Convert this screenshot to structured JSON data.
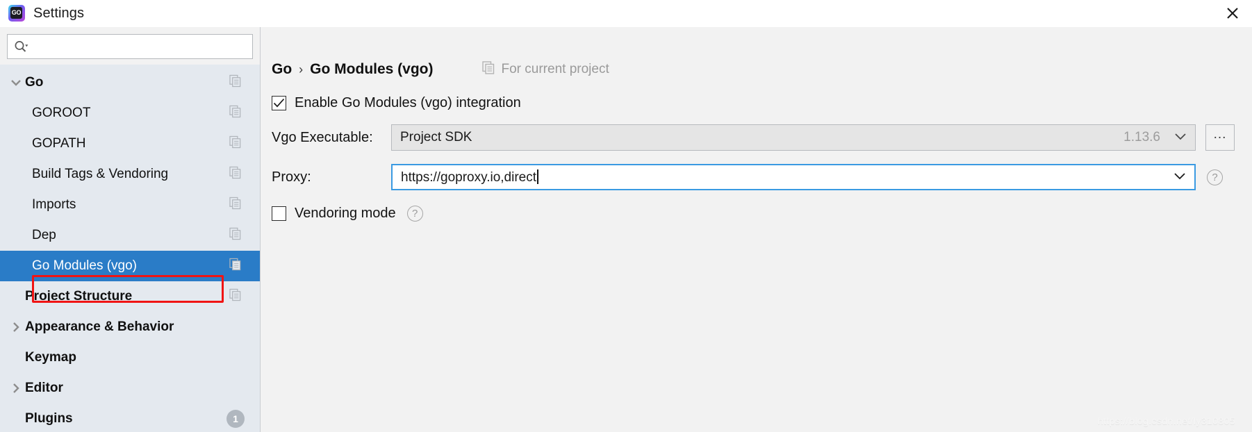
{
  "window": {
    "title": "Settings",
    "app_icon": "goland-icon",
    "app_icon_text": "GO",
    "close_label": "×"
  },
  "sidebar": {
    "search": {
      "placeholder": "",
      "value": "",
      "icon": "search-icon"
    },
    "items": [
      {
        "label": "Go",
        "level": 0,
        "bold": true,
        "twisty": "down",
        "copy": true,
        "selected": false
      },
      {
        "label": "GOROOT",
        "level": 1,
        "bold": false,
        "twisty": "none",
        "copy": true,
        "selected": false
      },
      {
        "label": "GOPATH",
        "level": 1,
        "bold": false,
        "twisty": "none",
        "copy": true,
        "selected": false
      },
      {
        "label": "Build Tags & Vendoring",
        "level": 1,
        "bold": false,
        "twisty": "none",
        "copy": true,
        "selected": false
      },
      {
        "label": "Imports",
        "level": 1,
        "bold": false,
        "twisty": "none",
        "copy": true,
        "selected": false
      },
      {
        "label": "Dep",
        "level": 1,
        "bold": false,
        "twisty": "none",
        "copy": true,
        "selected": false
      },
      {
        "label": "Go Modules (vgo)",
        "level": 1,
        "bold": false,
        "twisty": "none",
        "copy": true,
        "selected": true
      },
      {
        "label": "Project Structure",
        "level": 0,
        "bold": true,
        "twisty": "none",
        "copy": true,
        "selected": false
      },
      {
        "label": "Appearance & Behavior",
        "level": 0,
        "bold": true,
        "twisty": "right",
        "copy": false,
        "selected": false
      },
      {
        "label": "Keymap",
        "level": 0,
        "bold": true,
        "twisty": "none",
        "copy": false,
        "selected": false
      },
      {
        "label": "Editor",
        "level": 0,
        "bold": true,
        "twisty": "right",
        "copy": false,
        "selected": false
      },
      {
        "label": "Plugins",
        "level": 0,
        "bold": true,
        "twisty": "none",
        "copy": false,
        "selected": false,
        "badge": "1"
      }
    ],
    "selection_highlight_color": "#2a7cc7",
    "annotation_color": "#f01414"
  },
  "main": {
    "breadcrumb": {
      "root": "Go",
      "separator": "›",
      "leaf": "Go Modules (vgo)"
    },
    "scope_note": {
      "icon": "copy-icon",
      "text": "For current project"
    },
    "enable_checkbox": {
      "label": "Enable Go Modules (vgo) integration",
      "checked": true
    },
    "vgo_executable": {
      "label": "Vgo Executable:",
      "value": "Project SDK",
      "version": "1.13.6",
      "dropdown_icon": "chevron-down-icon",
      "browse_label": "...",
      "enabled": false
    },
    "proxy": {
      "label": "Proxy:",
      "value": "https://goproxy.io,direct",
      "placeholder": "",
      "dropdown_icon": "chevron-down-icon",
      "help_icon": "question-circle-icon",
      "focused": true
    },
    "vendoring": {
      "label": "Vendoring mode",
      "checked": false,
      "help_icon": "question-circle-icon"
    },
    "watermark": "https://blog.csdn.net/ly310805"
  }
}
